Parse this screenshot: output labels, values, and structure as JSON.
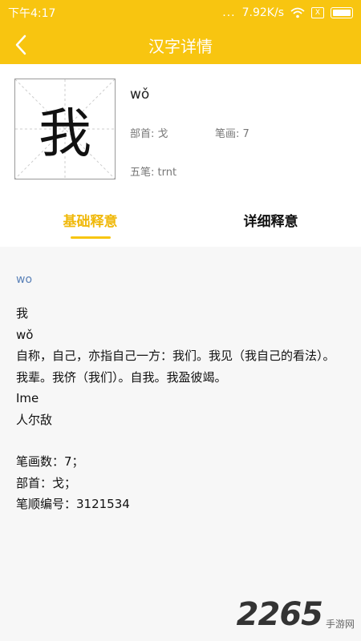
{
  "status": {
    "time": "下午4:17",
    "dots": "...",
    "net_speed": "7.92K/s",
    "sim_label": "X"
  },
  "header": {
    "title": "汉字详情",
    "back_icon": "chevron-left-icon"
  },
  "character": {
    "glyph": "我",
    "pinyin": "wǒ",
    "radical": "部首: 戈",
    "strokes": "笔画: 7",
    "wubi": "五笔: trnt"
  },
  "tabs": [
    {
      "label": "基础释意",
      "active": true
    },
    {
      "label": "详细释意",
      "active": false
    }
  ],
  "content": {
    "word": "wo",
    "lines": {
      "char": "我",
      "pinyin": "wǒ",
      "definition": "自称，自己，亦指自己一方：我们。我见（我自己的看法）。我辈。我侪（我们）。自我。我盈彼竭。",
      "english": "Ime",
      "antonym": "人尔敌",
      "stroke_count": "笔画数：7；",
      "radical": "部首：戈；",
      "stroke_order": "笔顺编号：3121534"
    }
  },
  "watermark": {
    "number": "2265",
    "text": "手游网"
  },
  "colors": {
    "accent": "#f8c510",
    "tab_active": "#f0b90b",
    "word_label": "#5b82b8"
  }
}
